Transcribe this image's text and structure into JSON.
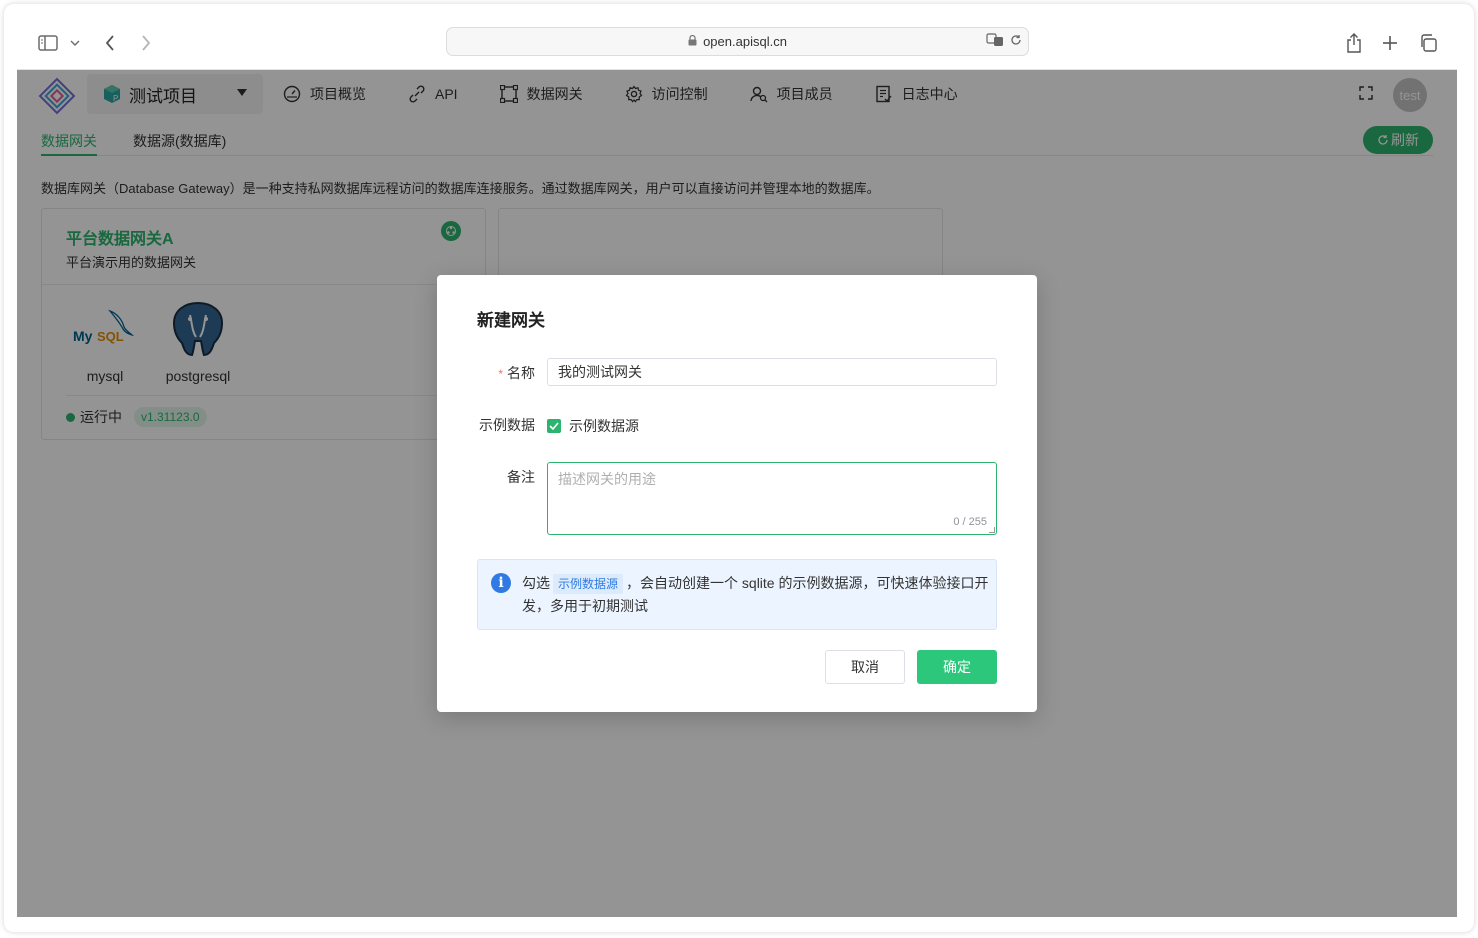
{
  "browser": {
    "url": "open.apisql.cn"
  },
  "app": {
    "project_name": "测试项目",
    "nav": [
      {
        "label": "项目概览",
        "icon": "gauge-icon"
      },
      {
        "label": "API",
        "icon": "link-icon"
      },
      {
        "label": "数据网关",
        "icon": "gateway-icon"
      },
      {
        "label": "访问控制",
        "icon": "gear-icon"
      },
      {
        "label": "项目成员",
        "icon": "members-icon"
      },
      {
        "label": "日志中心",
        "icon": "log-icon"
      }
    ],
    "avatar_text": "test",
    "subtabs": [
      "数据网关",
      "数据源(数据库)"
    ],
    "refresh_label": "刷新",
    "description": "数据库网关（Database Gateway）是一种支持私网数据库远程访问的数据库连接服务。通过数据库网关，用户可以直接访问并管理本地的数据库。",
    "card": {
      "title": "平台数据网关A",
      "subtitle": "平台演示用的数据网关",
      "databases": [
        "mysql",
        "postgresql"
      ],
      "status": "运行中",
      "version": "v1.31123.0"
    }
  },
  "modal": {
    "title": "新建网关",
    "name_label": "名称",
    "name_value": "我的测试网关",
    "sample_label": "示例数据",
    "sample_checkbox_label": "示例数据源",
    "sample_checked": true,
    "note_label": "备注",
    "note_placeholder": "描述网关的用途",
    "note_counter": "0 / 255",
    "info_prefix": "勾选",
    "info_tag": "示例数据源",
    "info_suffix": "，会自动创建一个 sqlite 的示例数据源，可快速体验接口开发，多用于初期测试",
    "cancel_label": "取消",
    "ok_label": "确定"
  },
  "colors": {
    "accent": "#2cb36d",
    "info": "#2f7be3"
  }
}
